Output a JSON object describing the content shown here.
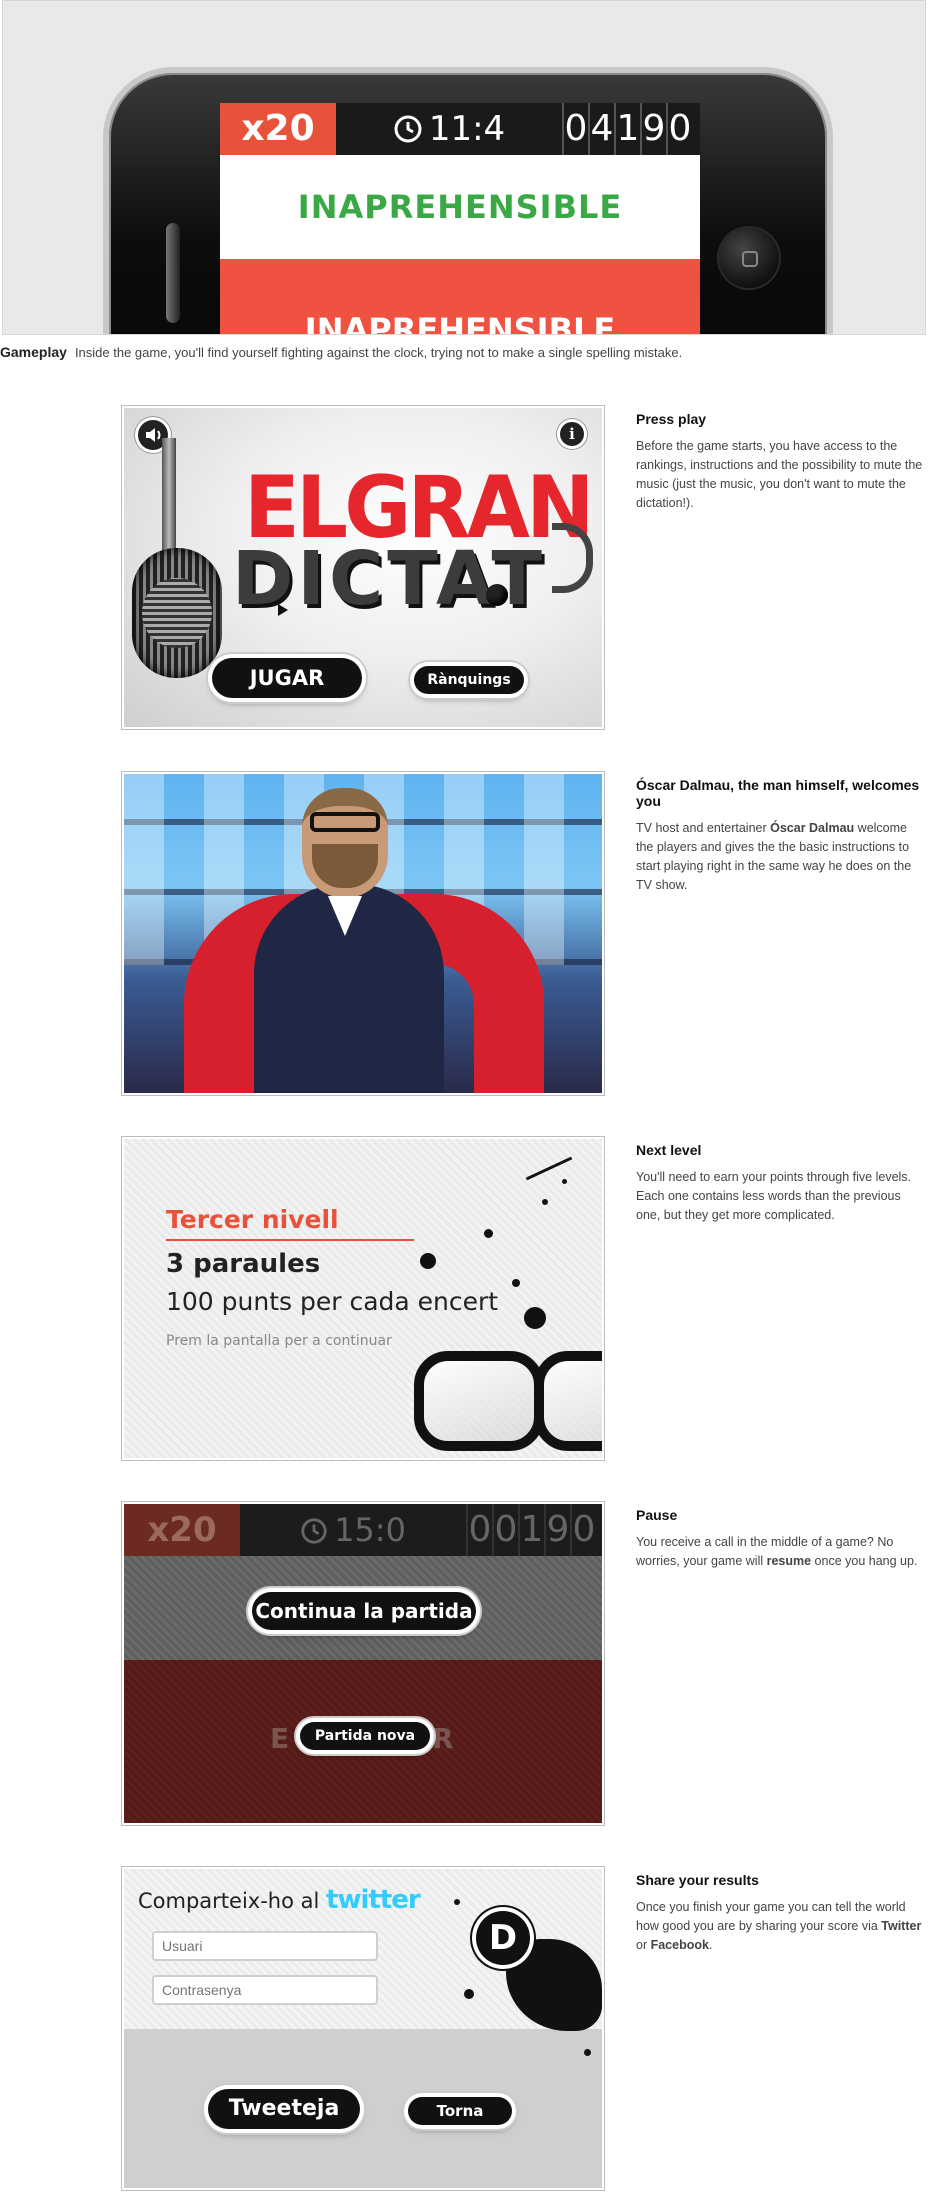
{
  "hero": {
    "multiplier": "x20",
    "timer": "11:4",
    "score_digits": [
      "0",
      "4",
      "1",
      "9",
      "0"
    ],
    "word_correct": "INAPREHENSIBLE",
    "word_typing": "INAPREHENSIBLE",
    "clock_icon": "clock-icon"
  },
  "caption": {
    "title": "Gameplay",
    "text": "Inside the game, you'll find yourself fighting against the clock, trying not to make a single spelling mistake."
  },
  "sections": [
    {
      "title": "Press play",
      "body": "Before the game starts, you have access to the rankings, instructions and the possibility to mute the music (just the music, you don't want to mute the dictation!).",
      "screen": {
        "logo_line1": "ELGRAN",
        "logo_line2": "DICTAT",
        "play_button": "JUGAR",
        "rankings_button": "Rànquings",
        "sound_icon": "speaker-icon",
        "info_icon": "info-icon"
      }
    },
    {
      "title": "Óscar Dalmau, the man himself, welcomes you",
      "body_before": "TV host and entertainer ",
      "body_bold": "Óscar Dalmau",
      "body_after": " welcome the players and gives the the basic instructions to start playing right in the same way he does on the TV show."
    },
    {
      "title": "Next level",
      "body": "You'll need to earn your points through five levels. Each one contains less words than the previous one, but they get more complicated.",
      "screen": {
        "level_title": "Tercer nivell",
        "words": "3 paraules",
        "points": "100 punts per cada encert",
        "hint": "Prem la pantalla per a continuar"
      }
    },
    {
      "title": "Pause",
      "body_before": "You receive a call in the middle of a game? No worries, your game will ",
      "body_bold": "resume",
      "body_after": " once you hang up.",
      "screen": {
        "multiplier": "x20",
        "timer": "15:0",
        "score_digits": [
          "0",
          "0",
          "1",
          "9",
          "0"
        ],
        "continue_button": "Continua la partida",
        "new_game_button": "Partida nova",
        "faded_left": "E",
        "faded_right": "R"
      }
    },
    {
      "title": "Share your results",
      "body_before": "Once you finish your game you can tell the world how good you are by sharing your score via ",
      "body_bold1": "Twitter",
      "body_mid": " or ",
      "body_bold2": "Facebook",
      "body_after": ".",
      "screen": {
        "share_prefix": "Comparteix-ho al",
        "brand": "twitter",
        "user_placeholder": "Usuari",
        "password_placeholder": "Contrasenya",
        "tweet_button": "Tweeteja",
        "back_button": "Torna",
        "badge_letter": "D"
      }
    }
  ],
  "colors": {
    "accent_red": "#ef5240",
    "correct_green": "#39a845",
    "twitter_blue": "#33ccff"
  }
}
